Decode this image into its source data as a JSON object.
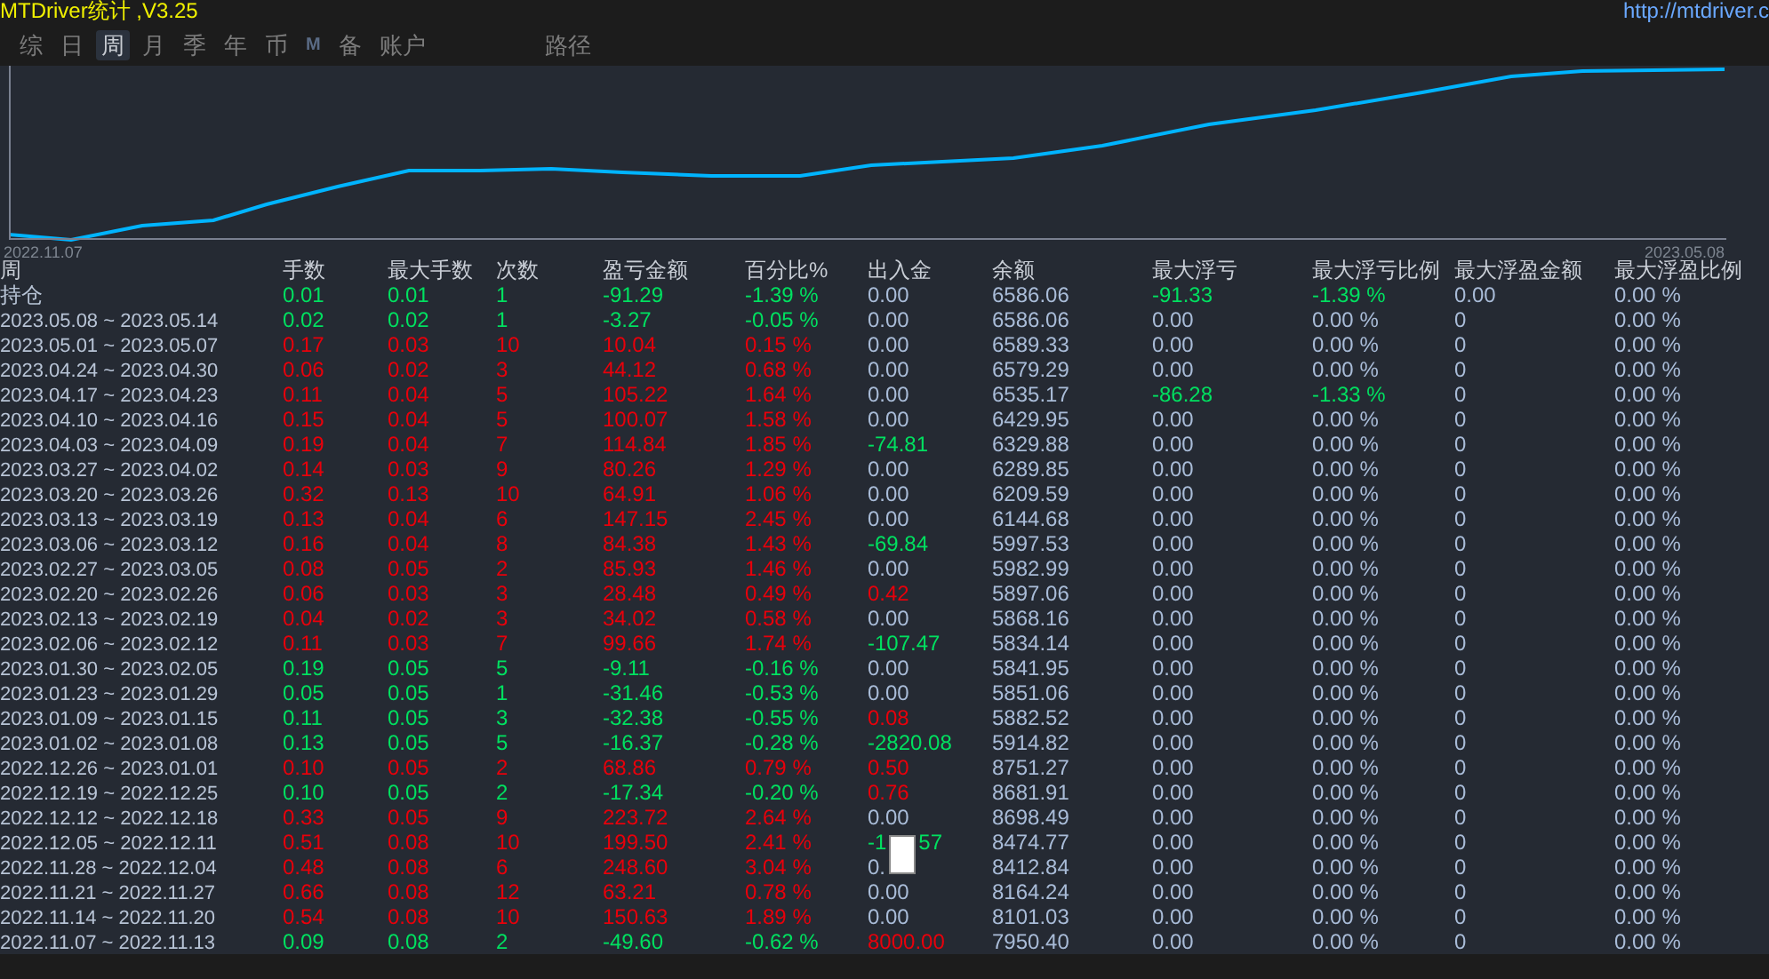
{
  "title": "MTDriver统计 ,V3.25",
  "link": "http://mtdriver.c",
  "tabs": [
    {
      "label": "综",
      "selected": false
    },
    {
      "label": "日",
      "selected": false
    },
    {
      "label": "周",
      "selected": true
    },
    {
      "label": "月",
      "selected": false
    },
    {
      "label": "季",
      "selected": false
    },
    {
      "label": "年",
      "selected": false
    },
    {
      "label": "币",
      "selected": false
    },
    {
      "label": "M",
      "selected": false,
      "kind": "mark"
    },
    {
      "label": "备",
      "selected": false
    },
    {
      "label": "账户",
      "selected": false
    }
  ],
  "path_label": "路径",
  "chart": {
    "x_start": "2022.11.07",
    "x_end": "2023.05.08"
  },
  "table": {
    "week_header": "周",
    "columns": [
      "手数",
      "最大手数",
      "次数",
      "盈亏金额",
      "百分比%",
      "出入金",
      "余额",
      "最大浮亏",
      "最大浮亏比例",
      "最大浮盈金额",
      "最大浮盈比例"
    ],
    "rows": [
      {
        "week": "持仓",
        "cells": [
          {
            "text": "0.01",
            "color": "#00e060"
          },
          {
            "text": "0.01",
            "color": "#00e060"
          },
          {
            "text": "1",
            "color": "#00e060"
          },
          {
            "text": "-91.29",
            "color": "#00e060"
          },
          {
            "text": "-1.39 %",
            "color": "#00e060"
          },
          {
            "text": "0.00"
          },
          {
            "text": "6586.06"
          },
          {
            "text": "-91.33",
            "color": "#00e060"
          },
          {
            "text": "-1.39 %",
            "color": "#00e060"
          },
          {
            "text": "0.00"
          },
          {
            "text": "0.00 %"
          }
        ]
      },
      {
        "week": "2023.05.08 ~ 2023.05.14",
        "cells": [
          {
            "text": "0.02",
            "color": "#00e060"
          },
          {
            "text": "0.02",
            "color": "#00e060"
          },
          {
            "text": "1",
            "color": "#00e060"
          },
          {
            "text": "-3.27",
            "color": "#00e060"
          },
          {
            "text": "-0.05 %",
            "color": "#00e060"
          },
          {
            "text": "0.00"
          },
          {
            "text": "6586.06"
          },
          {
            "text": "0.00"
          },
          {
            "text": "0.00 %"
          },
          {
            "text": "0"
          },
          {
            "text": "0.00 %"
          }
        ]
      },
      {
        "week": "2023.05.01 ~ 2023.05.07",
        "cells": [
          {
            "text": "0.17",
            "color": "#e8000b"
          },
          {
            "text": "0.03",
            "color": "#e8000b"
          },
          {
            "text": "10",
            "color": "#e8000b"
          },
          {
            "text": "10.04",
            "color": "#e8000b"
          },
          {
            "text": "0.15 %",
            "color": "#e8000b"
          },
          {
            "text": "0.00"
          },
          {
            "text": "6589.33"
          },
          {
            "text": "0.00"
          },
          {
            "text": "0.00 %"
          },
          {
            "text": "0"
          },
          {
            "text": "0.00 %"
          }
        ]
      },
      {
        "week": "2023.04.24 ~ 2023.04.30",
        "cells": [
          {
            "text": "0.06",
            "color": "#e8000b"
          },
          {
            "text": "0.02",
            "color": "#e8000b"
          },
          {
            "text": "3",
            "color": "#e8000b"
          },
          {
            "text": "44.12",
            "color": "#e8000b"
          },
          {
            "text": "0.68 %",
            "color": "#e8000b"
          },
          {
            "text": "0.00"
          },
          {
            "text": "6579.29"
          },
          {
            "text": "0.00"
          },
          {
            "text": "0.00 %"
          },
          {
            "text": "0"
          },
          {
            "text": "0.00 %"
          }
        ]
      },
      {
        "week": "2023.04.17 ~ 2023.04.23",
        "cells": [
          {
            "text": "0.11",
            "color": "#e8000b"
          },
          {
            "text": "0.04",
            "color": "#e8000b"
          },
          {
            "text": "5",
            "color": "#e8000b"
          },
          {
            "text": "105.22",
            "color": "#e8000b"
          },
          {
            "text": "1.64 %",
            "color": "#e8000b"
          },
          {
            "text": "0.00"
          },
          {
            "text": "6535.17"
          },
          {
            "text": "-86.28",
            "color": "#00e060"
          },
          {
            "text": "-1.33 %",
            "color": "#00e060"
          },
          {
            "text": "0"
          },
          {
            "text": "0.00 %"
          }
        ]
      },
      {
        "week": "2023.04.10 ~ 2023.04.16",
        "cells": [
          {
            "text": "0.15",
            "color": "#e8000b"
          },
          {
            "text": "0.04",
            "color": "#e8000b"
          },
          {
            "text": "5",
            "color": "#e8000b"
          },
          {
            "text": "100.07",
            "color": "#e8000b"
          },
          {
            "text": "1.58 %",
            "color": "#e8000b"
          },
          {
            "text": "0.00"
          },
          {
            "text": "6429.95"
          },
          {
            "text": "0.00"
          },
          {
            "text": "0.00 %"
          },
          {
            "text": "0"
          },
          {
            "text": "0.00 %"
          }
        ]
      },
      {
        "week": "2023.04.03 ~ 2023.04.09",
        "cells": [
          {
            "text": "0.19",
            "color": "#e8000b"
          },
          {
            "text": "0.04",
            "color": "#e8000b"
          },
          {
            "text": "7",
            "color": "#e8000b"
          },
          {
            "text": "114.84",
            "color": "#e8000b"
          },
          {
            "text": "1.85 %",
            "color": "#e8000b"
          },
          {
            "text": "-74.81",
            "color": "#00e060"
          },
          {
            "text": "6329.88"
          },
          {
            "text": "0.00"
          },
          {
            "text": "0.00 %"
          },
          {
            "text": "0"
          },
          {
            "text": "0.00 %"
          }
        ]
      },
      {
        "week": "2023.03.27 ~ 2023.04.02",
        "cells": [
          {
            "text": "0.14",
            "color": "#e8000b"
          },
          {
            "text": "0.03",
            "color": "#e8000b"
          },
          {
            "text": "9",
            "color": "#e8000b"
          },
          {
            "text": "80.26",
            "color": "#e8000b"
          },
          {
            "text": "1.29 %",
            "color": "#e8000b"
          },
          {
            "text": "0.00"
          },
          {
            "text": "6289.85"
          },
          {
            "text": "0.00"
          },
          {
            "text": "0.00 %"
          },
          {
            "text": "0"
          },
          {
            "text": "0.00 %"
          }
        ]
      },
      {
        "week": "2023.03.20 ~ 2023.03.26",
        "cells": [
          {
            "text": "0.32",
            "color": "#e8000b"
          },
          {
            "text": "0.13",
            "color": "#e8000b"
          },
          {
            "text": "10",
            "color": "#e8000b"
          },
          {
            "text": "64.91",
            "color": "#e8000b"
          },
          {
            "text": "1.06 %",
            "color": "#e8000b"
          },
          {
            "text": "0.00"
          },
          {
            "text": "6209.59"
          },
          {
            "text": "0.00"
          },
          {
            "text": "0.00 %"
          },
          {
            "text": "0"
          },
          {
            "text": "0.00 %"
          }
        ]
      },
      {
        "week": "2023.03.13 ~ 2023.03.19",
        "cells": [
          {
            "text": "0.13",
            "color": "#e8000b"
          },
          {
            "text": "0.04",
            "color": "#e8000b"
          },
          {
            "text": "6",
            "color": "#e8000b"
          },
          {
            "text": "147.15",
            "color": "#e8000b"
          },
          {
            "text": "2.45 %",
            "color": "#e8000b"
          },
          {
            "text": "0.00"
          },
          {
            "text": "6144.68"
          },
          {
            "text": "0.00"
          },
          {
            "text": "0.00 %"
          },
          {
            "text": "0"
          },
          {
            "text": "0.00 %"
          }
        ]
      },
      {
        "week": "2023.03.06 ~ 2023.03.12",
        "cells": [
          {
            "text": "0.16",
            "color": "#e8000b"
          },
          {
            "text": "0.04",
            "color": "#e8000b"
          },
          {
            "text": "8",
            "color": "#e8000b"
          },
          {
            "text": "84.38",
            "color": "#e8000b"
          },
          {
            "text": "1.43 %",
            "color": "#e8000b"
          },
          {
            "text": "-69.84",
            "color": "#00e060"
          },
          {
            "text": "5997.53"
          },
          {
            "text": "0.00"
          },
          {
            "text": "0.00 %"
          },
          {
            "text": "0"
          },
          {
            "text": "0.00 %"
          }
        ]
      },
      {
        "week": "2023.02.27 ~ 2023.03.05",
        "cells": [
          {
            "text": "0.08",
            "color": "#e8000b"
          },
          {
            "text": "0.05",
            "color": "#e8000b"
          },
          {
            "text": "2",
            "color": "#e8000b"
          },
          {
            "text": "85.93",
            "color": "#e8000b"
          },
          {
            "text": "1.46 %",
            "color": "#e8000b"
          },
          {
            "text": "0.00"
          },
          {
            "text": "5982.99"
          },
          {
            "text": "0.00"
          },
          {
            "text": "0.00 %"
          },
          {
            "text": "0"
          },
          {
            "text": "0.00 %"
          }
        ]
      },
      {
        "week": "2023.02.20 ~ 2023.02.26",
        "cells": [
          {
            "text": "0.06",
            "color": "#e8000b"
          },
          {
            "text": "0.03",
            "color": "#e8000b"
          },
          {
            "text": "3",
            "color": "#e8000b"
          },
          {
            "text": "28.48",
            "color": "#e8000b"
          },
          {
            "text": "0.49 %",
            "color": "#e8000b"
          },
          {
            "text": "0.42",
            "color": "#e8000b"
          },
          {
            "text": "5897.06"
          },
          {
            "text": "0.00"
          },
          {
            "text": "0.00 %"
          },
          {
            "text": "0"
          },
          {
            "text": "0.00 %"
          }
        ]
      },
      {
        "week": "2023.02.13 ~ 2023.02.19",
        "cells": [
          {
            "text": "0.04",
            "color": "#e8000b"
          },
          {
            "text": "0.02",
            "color": "#e8000b"
          },
          {
            "text": "3",
            "color": "#e8000b"
          },
          {
            "text": "34.02",
            "color": "#e8000b"
          },
          {
            "text": "0.58 %",
            "color": "#e8000b"
          },
          {
            "text": "0.00"
          },
          {
            "text": "5868.16"
          },
          {
            "text": "0.00"
          },
          {
            "text": "0.00 %"
          },
          {
            "text": "0"
          },
          {
            "text": "0.00 %"
          }
        ]
      },
      {
        "week": "2023.02.06 ~ 2023.02.12",
        "cells": [
          {
            "text": "0.11",
            "color": "#e8000b"
          },
          {
            "text": "0.03",
            "color": "#e8000b"
          },
          {
            "text": "7",
            "color": "#e8000b"
          },
          {
            "text": "99.66",
            "color": "#e8000b"
          },
          {
            "text": "1.74 %",
            "color": "#e8000b"
          },
          {
            "text": "-107.47",
            "color": "#00e060"
          },
          {
            "text": "5834.14"
          },
          {
            "text": "0.00"
          },
          {
            "text": "0.00 %"
          },
          {
            "text": "0"
          },
          {
            "text": "0.00 %"
          }
        ]
      },
      {
        "week": "2023.01.30 ~ 2023.02.05",
        "cells": [
          {
            "text": "0.19",
            "color": "#00e060"
          },
          {
            "text": "0.05",
            "color": "#00e060"
          },
          {
            "text": "5",
            "color": "#00e060"
          },
          {
            "text": "-9.11",
            "color": "#00e060"
          },
          {
            "text": "-0.16 %",
            "color": "#00e060"
          },
          {
            "text": "0.00"
          },
          {
            "text": "5841.95"
          },
          {
            "text": "0.00"
          },
          {
            "text": "0.00 %"
          },
          {
            "text": "0"
          },
          {
            "text": "0.00 %"
          }
        ]
      },
      {
        "week": "2023.01.23 ~ 2023.01.29",
        "cells": [
          {
            "text": "0.05",
            "color": "#00e060"
          },
          {
            "text": "0.05",
            "color": "#00e060"
          },
          {
            "text": "1",
            "color": "#00e060"
          },
          {
            "text": "-31.46",
            "color": "#00e060"
          },
          {
            "text": "-0.53 %",
            "color": "#00e060"
          },
          {
            "text": "0.00"
          },
          {
            "text": "5851.06"
          },
          {
            "text": "0.00"
          },
          {
            "text": "0.00 %"
          },
          {
            "text": "0"
          },
          {
            "text": "0.00 %"
          }
        ]
      },
      {
        "week": "2023.01.09 ~ 2023.01.15",
        "cells": [
          {
            "text": "0.11",
            "color": "#00e060"
          },
          {
            "text": "0.05",
            "color": "#00e060"
          },
          {
            "text": "3",
            "color": "#00e060"
          },
          {
            "text": "-32.38",
            "color": "#00e060"
          },
          {
            "text": "-0.55 %",
            "color": "#00e060"
          },
          {
            "text": "0.08",
            "color": "#e8000b"
          },
          {
            "text": "5882.52"
          },
          {
            "text": "0.00"
          },
          {
            "text": "0.00 %"
          },
          {
            "text": "0"
          },
          {
            "text": "0.00 %"
          }
        ]
      },
      {
        "week": "2023.01.02 ~ 2023.01.08",
        "cells": [
          {
            "text": "0.13",
            "color": "#00e060"
          },
          {
            "text": "0.05",
            "color": "#00e060"
          },
          {
            "text": "5",
            "color": "#00e060"
          },
          {
            "text": "-16.37",
            "color": "#00e060"
          },
          {
            "text": "-0.28 %",
            "color": "#00e060"
          },
          {
            "text": "-2820.08",
            "color": "#00e060"
          },
          {
            "text": "5914.82"
          },
          {
            "text": "0.00"
          },
          {
            "text": "0.00 %"
          },
          {
            "text": "0"
          },
          {
            "text": "0.00 %"
          }
        ]
      },
      {
        "week": "2022.12.26 ~ 2023.01.01",
        "cells": [
          {
            "text": "0.10",
            "color": "#e8000b"
          },
          {
            "text": "0.05",
            "color": "#e8000b"
          },
          {
            "text": "2",
            "color": "#e8000b"
          },
          {
            "text": "68.86",
            "color": "#e8000b"
          },
          {
            "text": "0.79 %",
            "color": "#e8000b"
          },
          {
            "text": "0.50",
            "color": "#e8000b"
          },
          {
            "text": "8751.27"
          },
          {
            "text": "0.00"
          },
          {
            "text": "0.00 %"
          },
          {
            "text": "0"
          },
          {
            "text": "0.00 %"
          }
        ]
      },
      {
        "week": "2022.12.19 ~ 2022.12.25",
        "cells": [
          {
            "text": "0.10",
            "color": "#00e060"
          },
          {
            "text": "0.05",
            "color": "#00e060"
          },
          {
            "text": "2",
            "color": "#00e060"
          },
          {
            "text": "-17.34",
            "color": "#00e060"
          },
          {
            "text": "-0.20 %",
            "color": "#00e060"
          },
          {
            "text": "0.76",
            "color": "#e8000b"
          },
          {
            "text": "8681.91"
          },
          {
            "text": "0.00"
          },
          {
            "text": "0.00 %"
          },
          {
            "text": "0"
          },
          {
            "text": "0.00 %"
          }
        ]
      },
      {
        "week": "2022.12.12 ~ 2022.12.18",
        "cells": [
          {
            "text": "0.33",
            "color": "#e8000b"
          },
          {
            "text": "0.05",
            "color": "#e8000b"
          },
          {
            "text": "9",
            "color": "#e8000b"
          },
          {
            "text": "223.72",
            "color": "#e8000b"
          },
          {
            "text": "2.64 %",
            "color": "#e8000b"
          },
          {
            "text": "0.00"
          },
          {
            "text": "8698.49"
          },
          {
            "text": "0.00"
          },
          {
            "text": "0.00 %"
          },
          {
            "text": "0"
          },
          {
            "text": "0.00 %"
          }
        ]
      },
      {
        "week": "2022.12.05 ~ 2022.12.11",
        "cells": [
          {
            "text": "0.51",
            "color": "#e8000b"
          },
          {
            "text": "0.08",
            "color": "#e8000b"
          },
          {
            "text": "10",
            "color": "#e8000b"
          },
          {
            "text": "199.50",
            "color": "#e8000b"
          },
          {
            "text": "2.41 %",
            "color": "#e8000b"
          },
          {
            "text": "-1",
            "tail": "57",
            "overlay": true,
            "color": "#00e060"
          },
          {
            "text": "8474.77"
          },
          {
            "text": "0.00"
          },
          {
            "text": "0.00 %"
          },
          {
            "text": "0"
          },
          {
            "text": "0.00 %"
          }
        ]
      },
      {
        "week": "2022.11.28 ~ 2022.12.04",
        "cells": [
          {
            "text": "0.48",
            "color": "#e8000b"
          },
          {
            "text": "0.08",
            "color": "#e8000b"
          },
          {
            "text": "6",
            "color": "#e8000b"
          },
          {
            "text": "248.60",
            "color": "#e8000b"
          },
          {
            "text": "3.04 %",
            "color": "#e8000b"
          },
          {
            "text": "0."
          },
          {
            "text": "8412.84"
          },
          {
            "text": "0.00"
          },
          {
            "text": "0.00 %"
          },
          {
            "text": "0"
          },
          {
            "text": "0.00 %"
          }
        ]
      },
      {
        "week": "2022.11.21 ~ 2022.11.27",
        "cells": [
          {
            "text": "0.66",
            "color": "#e8000b"
          },
          {
            "text": "0.08",
            "color": "#e8000b"
          },
          {
            "text": "12",
            "color": "#e8000b"
          },
          {
            "text": "63.21",
            "color": "#e8000b"
          },
          {
            "text": "0.78 %",
            "color": "#e8000b"
          },
          {
            "text": "0.00"
          },
          {
            "text": "8164.24"
          },
          {
            "text": "0.00"
          },
          {
            "text": "0.00 %"
          },
          {
            "text": "0"
          },
          {
            "text": "0.00 %"
          }
        ]
      },
      {
        "week": "2022.11.14 ~ 2022.11.20",
        "cells": [
          {
            "text": "0.54",
            "color": "#e8000b"
          },
          {
            "text": "0.08",
            "color": "#e8000b"
          },
          {
            "text": "10",
            "color": "#e8000b"
          },
          {
            "text": "150.63",
            "color": "#e8000b"
          },
          {
            "text": "1.89 %",
            "color": "#e8000b"
          },
          {
            "text": "0.00"
          },
          {
            "text": "8101.03"
          },
          {
            "text": "0.00"
          },
          {
            "text": "0.00 %"
          },
          {
            "text": "0"
          },
          {
            "text": "0.00 %"
          }
        ]
      },
      {
        "week": "2022.11.07 ~ 2022.11.13",
        "cells": [
          {
            "text": "0.09",
            "color": "#00e060"
          },
          {
            "text": "0.08",
            "color": "#00e060"
          },
          {
            "text": "2",
            "color": "#00e060"
          },
          {
            "text": "-49.60",
            "color": "#00e060"
          },
          {
            "text": "-0.62 %",
            "color": "#00e060"
          },
          {
            "text": "8000.00",
            "color": "#e8000b"
          },
          {
            "text": "7950.40"
          },
          {
            "text": "0.00"
          },
          {
            "text": "0.00 %"
          },
          {
            "text": "0"
          },
          {
            "text": "0.00 %"
          }
        ]
      }
    ]
  }
}
